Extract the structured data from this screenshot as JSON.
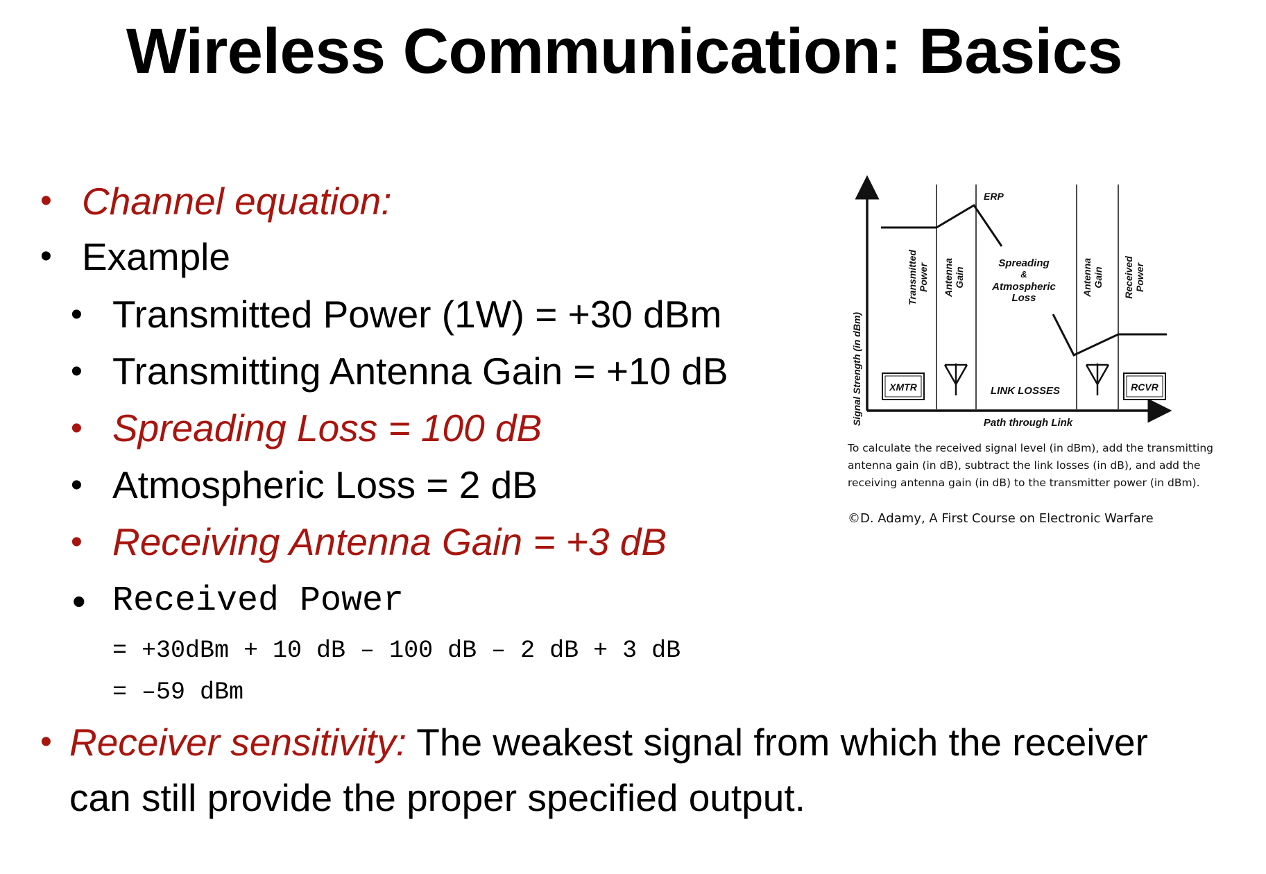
{
  "slide": {
    "title": "Wireless Communication: Basics",
    "bullets": {
      "channel_equation": "Channel equation:",
      "example": "Example",
      "transmitted_power": "Transmitted Power (1W) = +30 dBm",
      "tx_antenna_gain": "Transmitting Antenna Gain = +10 dB",
      "spreading_loss": "Spreading Loss = 100 dB",
      "atmospheric_loss": "Atmospheric Loss = 2 dB",
      "rx_antenna_gain": "Receiving Antenna Gain = +3 dB",
      "received_power": "Received Power",
      "calc_line1": "= +30dBm + 10 dB – 100 dB – 2 dB + 3 dB",
      "calc_line2": "= –59 dBm",
      "sensitivity_term": "Receiver sensitivity:",
      "sensitivity_def_line1": " The weakest signal from which the receiver",
      "sensitivity_def_line2": "can still provide the proper specified output."
    },
    "figure": {
      "y_axis_label": "Signal Strength (in dBm)",
      "x_axis_label": "Path through Link",
      "erp_label": "ERP",
      "column_labels": {
        "transmitted_power": [
          "Transmitted",
          "Power"
        ],
        "antenna_gain_tx": [
          "Antenna",
          "Gain"
        ],
        "spreading": [
          "Spreading",
          "&",
          "Atmospheric",
          "Loss"
        ],
        "antenna_gain_rx": [
          "Antenna",
          "Gain"
        ],
        "received_power": [
          "Received",
          "Power"
        ]
      },
      "xmtr_label": "XMTR",
      "link_losses_label": "LINK LOSSES",
      "rcvr_label": "RCVR",
      "caption": "To calculate the received signal level (in dBm), add the transmitting antenna gain (in dB), subtract the link losses (in dB), and add the receiving antenna gain (in dB) to the transmitter power (in dBm).",
      "credit": "©D. Adamy, A First Course on Electronic Warfare"
    },
    "colors": {
      "accent_red": "#a8150e",
      "text": "#000000"
    }
  }
}
